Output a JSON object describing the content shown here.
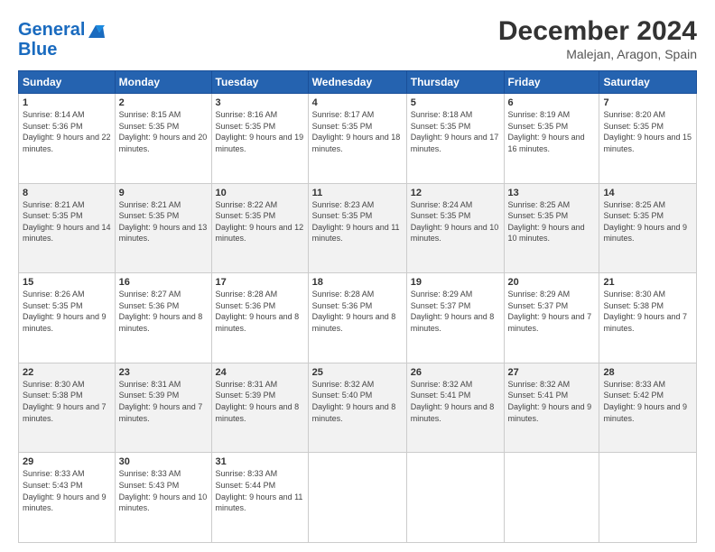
{
  "header": {
    "logo_line1": "General",
    "logo_line2": "Blue",
    "month": "December 2024",
    "location": "Malejan, Aragon, Spain"
  },
  "weekdays": [
    "Sunday",
    "Monday",
    "Tuesday",
    "Wednesday",
    "Thursday",
    "Friday",
    "Saturday"
  ],
  "weeks": [
    [
      {
        "day": "1",
        "sunrise": "8:14 AM",
        "sunset": "5:36 PM",
        "daylight": "9 hours and 22 minutes."
      },
      {
        "day": "2",
        "sunrise": "8:15 AM",
        "sunset": "5:35 PM",
        "daylight": "9 hours and 20 minutes."
      },
      {
        "day": "3",
        "sunrise": "8:16 AM",
        "sunset": "5:35 PM",
        "daylight": "9 hours and 19 minutes."
      },
      {
        "day": "4",
        "sunrise": "8:17 AM",
        "sunset": "5:35 PM",
        "daylight": "9 hours and 18 minutes."
      },
      {
        "day": "5",
        "sunrise": "8:18 AM",
        "sunset": "5:35 PM",
        "daylight": "9 hours and 17 minutes."
      },
      {
        "day": "6",
        "sunrise": "8:19 AM",
        "sunset": "5:35 PM",
        "daylight": "9 hours and 16 minutes."
      },
      {
        "day": "7",
        "sunrise": "8:20 AM",
        "sunset": "5:35 PM",
        "daylight": "9 hours and 15 minutes."
      }
    ],
    [
      {
        "day": "8",
        "sunrise": "8:21 AM",
        "sunset": "5:35 PM",
        "daylight": "9 hours and 14 minutes."
      },
      {
        "day": "9",
        "sunrise": "8:21 AM",
        "sunset": "5:35 PM",
        "daylight": "9 hours and 13 minutes."
      },
      {
        "day": "10",
        "sunrise": "8:22 AM",
        "sunset": "5:35 PM",
        "daylight": "9 hours and 12 minutes."
      },
      {
        "day": "11",
        "sunrise": "8:23 AM",
        "sunset": "5:35 PM",
        "daylight": "9 hours and 11 minutes."
      },
      {
        "day": "12",
        "sunrise": "8:24 AM",
        "sunset": "5:35 PM",
        "daylight": "9 hours and 10 minutes."
      },
      {
        "day": "13",
        "sunrise": "8:25 AM",
        "sunset": "5:35 PM",
        "daylight": "9 hours and 10 minutes."
      },
      {
        "day": "14",
        "sunrise": "8:25 AM",
        "sunset": "5:35 PM",
        "daylight": "9 hours and 9 minutes."
      }
    ],
    [
      {
        "day": "15",
        "sunrise": "8:26 AM",
        "sunset": "5:35 PM",
        "daylight": "9 hours and 9 minutes."
      },
      {
        "day": "16",
        "sunrise": "8:27 AM",
        "sunset": "5:36 PM",
        "daylight": "9 hours and 8 minutes."
      },
      {
        "day": "17",
        "sunrise": "8:28 AM",
        "sunset": "5:36 PM",
        "daylight": "9 hours and 8 minutes."
      },
      {
        "day": "18",
        "sunrise": "8:28 AM",
        "sunset": "5:36 PM",
        "daylight": "9 hours and 8 minutes."
      },
      {
        "day": "19",
        "sunrise": "8:29 AM",
        "sunset": "5:37 PM",
        "daylight": "9 hours and 8 minutes."
      },
      {
        "day": "20",
        "sunrise": "8:29 AM",
        "sunset": "5:37 PM",
        "daylight": "9 hours and 7 minutes."
      },
      {
        "day": "21",
        "sunrise": "8:30 AM",
        "sunset": "5:38 PM",
        "daylight": "9 hours and 7 minutes."
      }
    ],
    [
      {
        "day": "22",
        "sunrise": "8:30 AM",
        "sunset": "5:38 PM",
        "daylight": "9 hours and 7 minutes."
      },
      {
        "day": "23",
        "sunrise": "8:31 AM",
        "sunset": "5:39 PM",
        "daylight": "9 hours and 7 minutes."
      },
      {
        "day": "24",
        "sunrise": "8:31 AM",
        "sunset": "5:39 PM",
        "daylight": "9 hours and 8 minutes."
      },
      {
        "day": "25",
        "sunrise": "8:32 AM",
        "sunset": "5:40 PM",
        "daylight": "9 hours and 8 minutes."
      },
      {
        "day": "26",
        "sunrise": "8:32 AM",
        "sunset": "5:41 PM",
        "daylight": "9 hours and 8 minutes."
      },
      {
        "day": "27",
        "sunrise": "8:32 AM",
        "sunset": "5:41 PM",
        "daylight": "9 hours and 9 minutes."
      },
      {
        "day": "28",
        "sunrise": "8:33 AM",
        "sunset": "5:42 PM",
        "daylight": "9 hours and 9 minutes."
      }
    ],
    [
      {
        "day": "29",
        "sunrise": "8:33 AM",
        "sunset": "5:43 PM",
        "daylight": "9 hours and 9 minutes."
      },
      {
        "day": "30",
        "sunrise": "8:33 AM",
        "sunset": "5:43 PM",
        "daylight": "9 hours and 10 minutes."
      },
      {
        "day": "31",
        "sunrise": "8:33 AM",
        "sunset": "5:44 PM",
        "daylight": "9 hours and 11 minutes."
      },
      null,
      null,
      null,
      null
    ]
  ]
}
